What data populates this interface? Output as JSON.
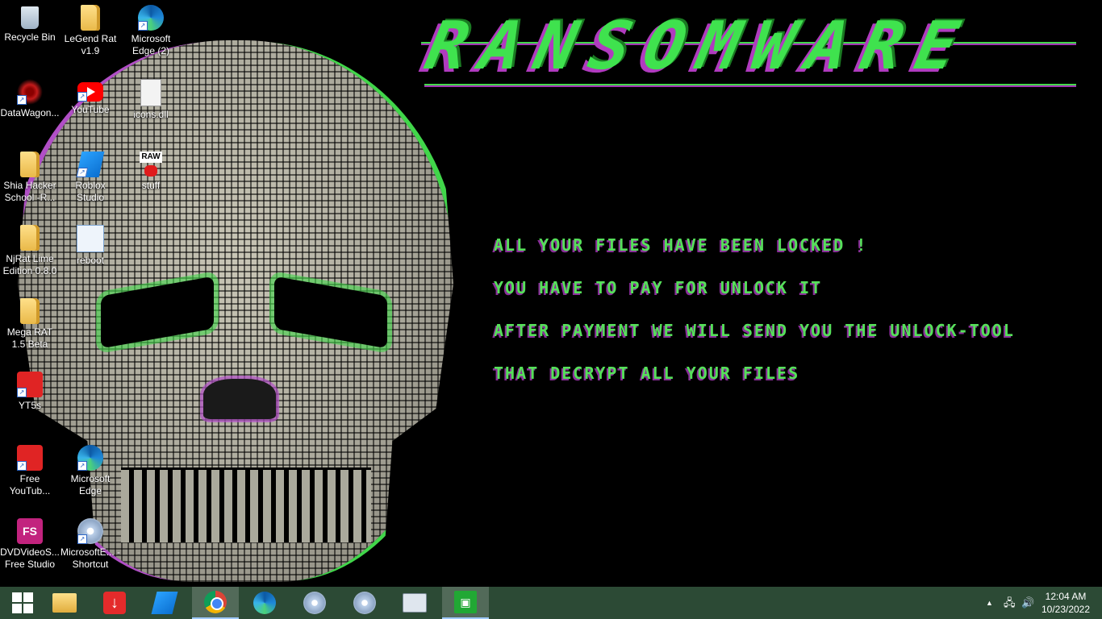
{
  "wallpaper": {
    "title": "RANSOMWARE",
    "lines": [
      "ALL YOUR FILES HAVE BEEN LOCKED !",
      "YOU HAVE TO PAY FOR UNLOCK IT",
      "AFTER PAYMENT WE WILL SEND YOU THE UNLOCK-TOOL",
      "THAT DECRYPT ALL YOUR FILES"
    ],
    "colors": {
      "text_green": "#56e05a",
      "glitch_purple": "#b03bbf"
    }
  },
  "desktop_icons": [
    {
      "label": "Recycle Bin",
      "icon": "recycle-bin-icon"
    },
    {
      "label": "LeGend Rat v1.9",
      "icon": "folder-icon"
    },
    {
      "label": "Microsoft Edge (2)",
      "icon": "edge-icon"
    },
    {
      "label": "DataWagon...",
      "icon": "datawagon-icon"
    },
    {
      "label": "YouTube",
      "icon": "youtube-icon"
    },
    {
      "label": "icons.dll",
      "icon": "dll-file-icon"
    },
    {
      "label": "Shia Hacker School -R...",
      "icon": "folder-icon"
    },
    {
      "label": "Roblox Studio",
      "icon": "roblox-studio-icon"
    },
    {
      "label": "stuff",
      "icon": "raw-image-icon",
      "badge": "RAW"
    },
    {
      "label": "NjRat Lime Edition 0.8.0",
      "icon": "folder-icon"
    },
    {
      "label": "reboot",
      "icon": "reboot-icon"
    },
    {
      "label": "Mega RAT 1.5 Beta",
      "icon": "folder-icon"
    },
    {
      "label": "YT5s",
      "icon": "yt5s-icon"
    },
    {
      "label": "Free YouTub...",
      "icon": "free-youtube-download-icon"
    },
    {
      "label": "Microsoft Edge",
      "icon": "edge-icon"
    },
    {
      "label": "DVDVideoS... Free Studio",
      "icon": "dvd-video-soft-icon",
      "badge": "FS"
    },
    {
      "label": "MicrosoftE... - Shortcut",
      "icon": "disc-shortcut-icon"
    }
  ],
  "taskbar": {
    "buttons": [
      {
        "name": "start",
        "icon": "windows-start-icon"
      },
      {
        "name": "file-explorer",
        "icon": "file-explorer-icon"
      },
      {
        "name": "free-youtube-download",
        "icon": "download-arrow-icon"
      },
      {
        "name": "roblox-studio",
        "icon": "roblox-studio-icon"
      },
      {
        "name": "chrome",
        "icon": "chrome-icon",
        "active": true
      },
      {
        "name": "edge",
        "icon": "edge-icon"
      },
      {
        "name": "disc-app-1",
        "icon": "disc-icon"
      },
      {
        "name": "disc-app-2",
        "icon": "disc-icon"
      },
      {
        "name": "monitor-app",
        "icon": "monitor-icon"
      },
      {
        "name": "store",
        "icon": "store-icon",
        "active": true
      }
    ],
    "tray": {
      "chevron": "▲",
      "time": "12:04 AM",
      "date": "10/23/2022"
    },
    "colors": {
      "background": "#2c4a35"
    }
  }
}
